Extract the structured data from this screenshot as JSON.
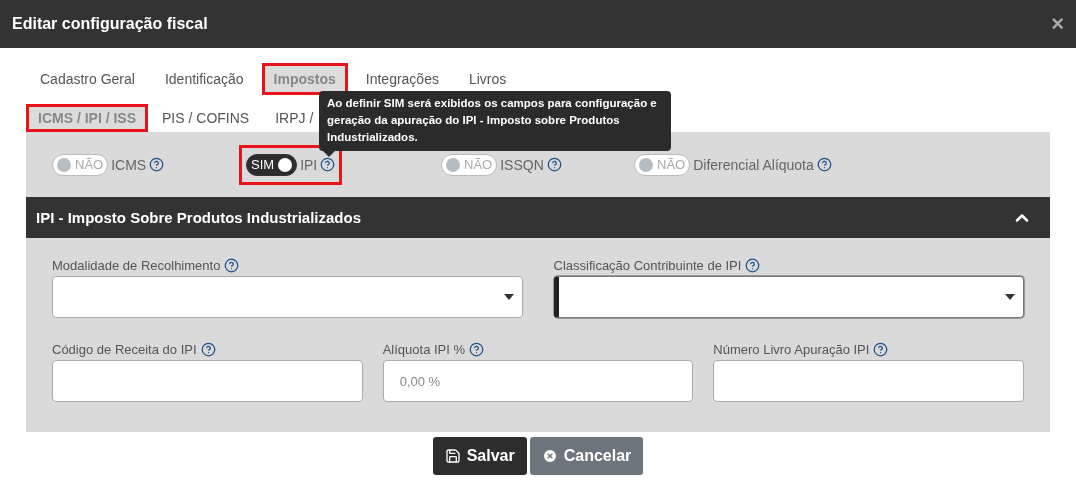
{
  "dialog": {
    "title": "Editar configuração fiscal",
    "close": "×"
  },
  "tabs": [
    {
      "label": "Cadastro Geral",
      "selected": false,
      "highlighted": false
    },
    {
      "label": "Identificação",
      "selected": false,
      "highlighted": false
    },
    {
      "label": "Impostos",
      "selected": true,
      "highlighted": true
    },
    {
      "label": "Integrações",
      "selected": false,
      "highlighted": false
    },
    {
      "label": "Livros",
      "selected": false,
      "highlighted": false
    }
  ],
  "subtabs": [
    {
      "label": "ICMS / IPI / ISS",
      "selected": true,
      "highlighted": true
    },
    {
      "label": "PIS / COFINS",
      "selected": false,
      "highlighted": false
    },
    {
      "label": "IRPJ /",
      "selected": false,
      "highlighted": false
    }
  ],
  "tooltip": {
    "text": "Ao definir SIM será exibidos os campos para configuração e geração da apuração do IPI - Imposto sobre Produtos Industrializados."
  },
  "toggles": [
    {
      "state_text": "NÃO",
      "label": "ICMS",
      "on": false,
      "highlighted": false
    },
    {
      "state_text": "SIM",
      "label": "IPI",
      "on": true,
      "highlighted": true
    },
    {
      "state_text": "NÃO",
      "label": "ISSQN",
      "on": false,
      "highlighted": false
    },
    {
      "state_text": "NÃO",
      "label": "Diferencial Alíquota",
      "on": false,
      "highlighted": false
    }
  ],
  "section": {
    "title": "IPI - Imposto Sobre Produtos Industrializados",
    "expanded": true,
    "rows": [
      [
        {
          "label": "Modalidade de Recolhimento",
          "kind": "select",
          "focused": false
        },
        {
          "label": "Classificação Contribuinte de IPI",
          "kind": "select",
          "focused": true
        }
      ],
      [
        {
          "label": "Código de Receita do IPI",
          "kind": "input",
          "focused": false
        },
        {
          "label": "Alíquota IPI %",
          "kind": "input",
          "placeholder": "0,00 %",
          "focused": false
        },
        {
          "label": "Número Livro Apuração IPI",
          "kind": "input",
          "focused": false
        }
      ]
    ]
  },
  "buttons": [
    {
      "label": "Salvar",
      "kind": "primary"
    },
    {
      "label": "Cancelar",
      "kind": "secondary"
    }
  ]
}
